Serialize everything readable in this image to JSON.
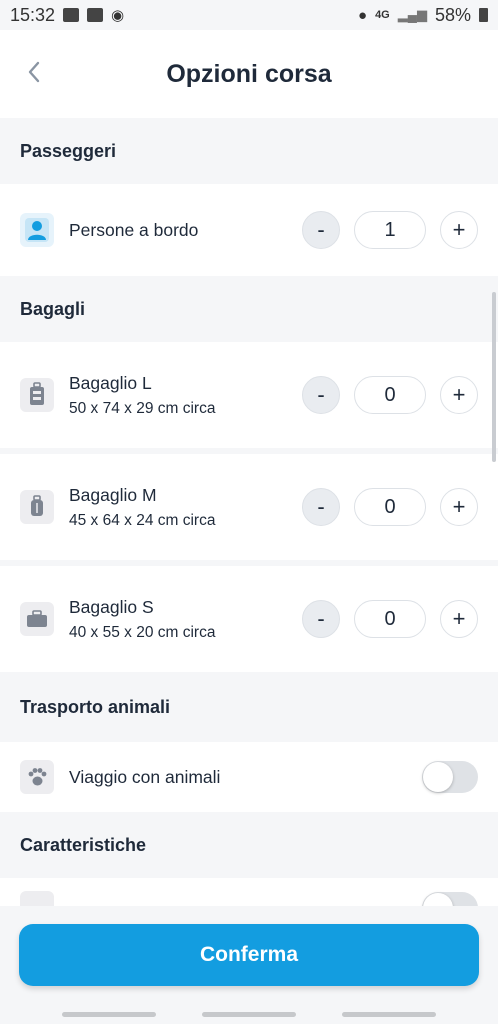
{
  "status": {
    "time": "15:32",
    "network": "4G",
    "battery": "58%"
  },
  "header": {
    "title": "Opzioni corsa"
  },
  "sections": {
    "passengers": {
      "title": "Passeggeri"
    },
    "luggage": {
      "title": "Bagagli"
    },
    "animals": {
      "title": "Trasporto animali"
    },
    "features": {
      "title": "Caratteristiche"
    }
  },
  "passengers": {
    "label": "Persone a bordo",
    "count": "1"
  },
  "luggage": [
    {
      "label": "Bagaglio L",
      "size": "50 x 74 x 29 cm circa",
      "count": "0"
    },
    {
      "label": "Bagaglio M",
      "size": "45 x 64 x 24 cm circa",
      "count": "0"
    },
    {
      "label": "Bagaglio S",
      "size": "40 x 55 x 20 cm circa",
      "count": "0"
    }
  ],
  "stepper": {
    "minus": "-",
    "plus": "+"
  },
  "animals": {
    "label": "Viaggio con animali",
    "enabled": false
  },
  "features": {
    "enabled": false
  },
  "confirm": {
    "label": "Conferma"
  },
  "colors": {
    "accent": "#139de0",
    "text": "#1f2a3a",
    "background": "#f5f6f8"
  }
}
